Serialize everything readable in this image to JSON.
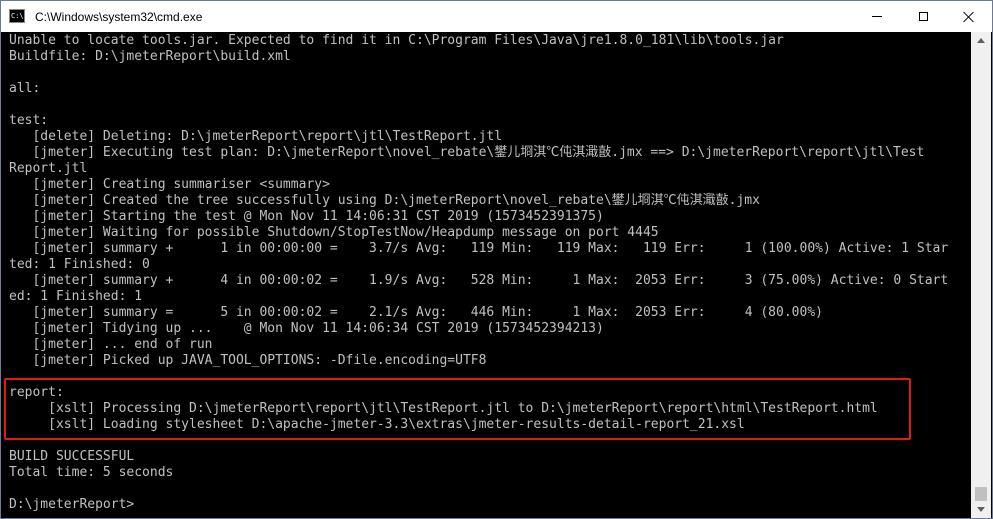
{
  "window": {
    "title": "C:\\Windows\\system32\\cmd.exe",
    "icon_text": "C:\\"
  },
  "console": {
    "lines": [
      "Unable to locate tools.jar. Expected to find it in C:\\Program Files\\Java\\jre1.8.0_181\\lib\\tools.jar",
      "Buildfile: D:\\jmeterReport\\build.xml",
      "",
      "all:",
      "",
      "test:",
      "   [delete] Deleting: D:\\jmeterReport\\report\\jtl\\TestReport.jtl",
      "   [jmeter] Executing test plan: D:\\jmeterReport\\novel_rebate\\鐢儿埛淇℃伅淇濈敼.jmx ==> D:\\jmeterReport\\report\\jtl\\Test",
      "Report.jtl",
      "   [jmeter] Creating summariser <summary>",
      "   [jmeter] Created the tree successfully using D:\\jmeterReport\\novel_rebate\\鐢儿埛淇℃伅淇濈敼.jmx",
      "   [jmeter] Starting the test @ Mon Nov 11 14:06:31 CST 2019 (1573452391375)",
      "   [jmeter] Waiting for possible Shutdown/StopTestNow/Heapdump message on port 4445",
      "   [jmeter] summary +      1 in 00:00:00 =    3.7/s Avg:   119 Min:   119 Max:   119 Err:     1 (100.00%) Active: 1 Star",
      "ted: 1 Finished: 0",
      "   [jmeter] summary +      4 in 00:00:02 =    1.9/s Avg:   528 Min:     1 Max:  2053 Err:     3 (75.00%) Active: 0 Start",
      "ed: 1 Finished: 1",
      "   [jmeter] summary =      5 in 00:00:02 =    2.1/s Avg:   446 Min:     1 Max:  2053 Err:     4 (80.00%)",
      "   [jmeter] Tidying up ...    @ Mon Nov 11 14:06:34 CST 2019 (1573452394213)",
      "   [jmeter] ... end of run",
      "   [jmeter] Picked up JAVA_TOOL_OPTIONS: -Dfile.encoding=UTF8",
      "",
      "report:",
      "     [xslt] Processing D:\\jmeterReport\\report\\jtl\\TestReport.jtl to D:\\jmeterReport\\report\\html\\TestReport.html",
      "     [xslt] Loading stylesheet D:\\apache-jmeter-3.3\\extras\\jmeter-results-detail-report_21.xsl",
      "",
      "BUILD SUCCESSFUL",
      "Total time: 5 seconds",
      "",
      "D:\\jmeterReport>"
    ]
  },
  "colors": {
    "console_bg": "#000000",
    "console_fg": "#c0c0c0",
    "highlight": "#e01a1a"
  }
}
